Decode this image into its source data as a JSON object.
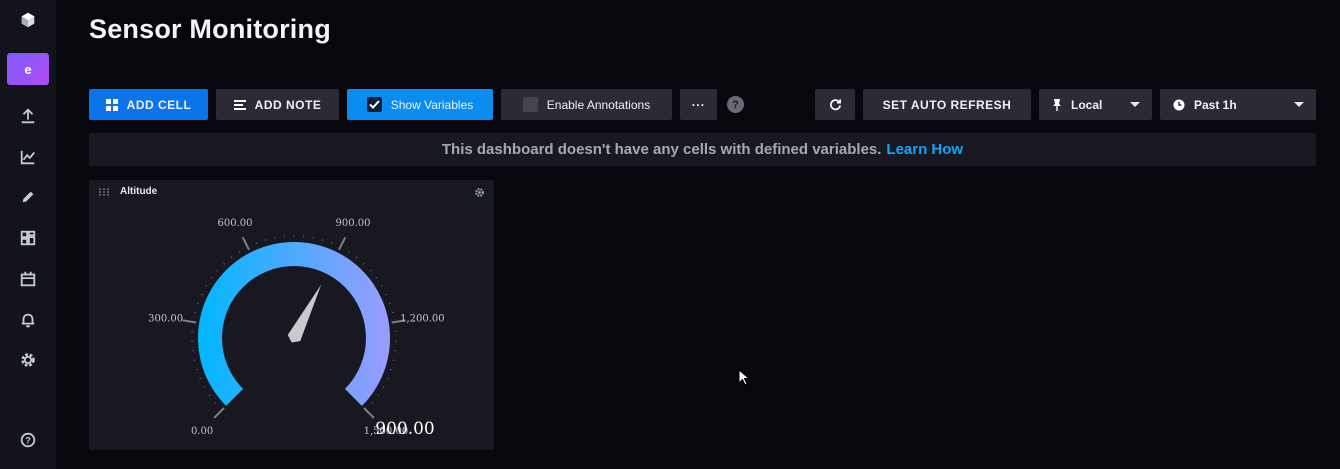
{
  "app": {
    "logo_icon": "cube-icon",
    "org_initial": "e"
  },
  "sidebar": {
    "items": [
      {
        "icon": "upload-icon",
        "name": "data"
      },
      {
        "icon": "graph-icon",
        "name": "data-explorer"
      },
      {
        "icon": "pencil-icon",
        "name": "notebooks"
      },
      {
        "icon": "dashboard-grid-icon",
        "name": "dashboards"
      },
      {
        "icon": "calendar-icon",
        "name": "tasks"
      },
      {
        "icon": "bell-icon",
        "name": "alerts"
      },
      {
        "icon": "gear-icon",
        "name": "settings"
      },
      {
        "icon": "help-icon",
        "name": "help"
      }
    ]
  },
  "page": {
    "title": "Sensor Monitoring"
  },
  "toolbar": {
    "add_cell": "ADD CELL",
    "add_note": "ADD NOTE",
    "show_variables": "Show Variables",
    "show_variables_checked": true,
    "enable_annotations": "Enable Annotations",
    "enable_annotations_checked": false,
    "more": "···",
    "help": "?",
    "refresh_icon": "refresh-icon",
    "auto_refresh": "SET AUTO REFRESH",
    "timezone": "Local",
    "time_range": "Past 1h"
  },
  "banner": {
    "message": "This dashboard doesn't have any cells with defined variables.",
    "link": "Learn How"
  },
  "cell": {
    "title": "Altitude",
    "gauge": {
      "min": 0,
      "max": 1500,
      "value": 900,
      "value_label": "900.00",
      "tick_labels": [
        "0.00",
        "300.00",
        "600.00",
        "900.00",
        "1,200.00",
        "1,500.00"
      ],
      "gradient_start": "#00b7ff",
      "gradient_end": "#9b9cff"
    }
  }
}
